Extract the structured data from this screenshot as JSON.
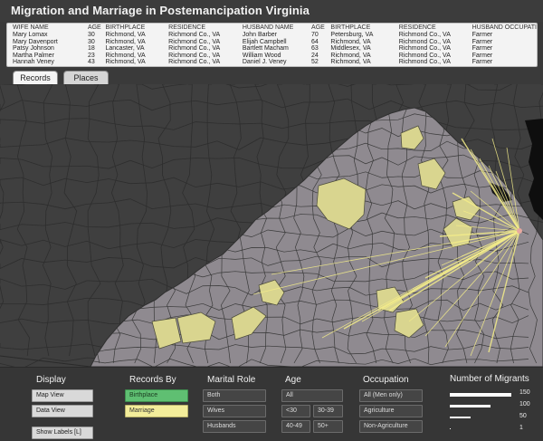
{
  "app": {
    "title": "Migration and Marriage in Postemancipation Virginia"
  },
  "records": {
    "headers": [
      "WIFE NAME",
      "AGE",
      "BIRTHPLACE",
      "RESIDENCE",
      "HUSBAND NAME",
      "AGE",
      "BIRTHPLACE",
      "RESIDENCE",
      "HUSBAND OCCUPATI"
    ],
    "rows": [
      [
        "Mary Lomax",
        "30",
        "Richmond, VA",
        "Richmond Co., VA",
        "John Barber",
        "70",
        "Petersburg, VA",
        "Richmond Co., VA",
        "Farmer"
      ],
      [
        "Mary Davenport",
        "30",
        "Richmond, VA",
        "Richmond Co., VA",
        "Elijah Campbell",
        "64",
        "Richmond, VA",
        "Richmond Co., VA",
        "Farmer"
      ],
      [
        "Patsy Johnson",
        "18",
        "Lancaster, VA",
        "Richmond Co., VA",
        "Bartlett Macham",
        "63",
        "Middlesex, VA",
        "Richmond Co., VA",
        "Farmer"
      ],
      [
        "Martha Palmer",
        "23",
        "Richmond, VA",
        "Richmond Co., VA",
        "William Wood",
        "24",
        "Richmond, VA",
        "Richmond Co., VA",
        "Farmer"
      ],
      [
        "Hannah Veney",
        "43",
        "Richmond, VA",
        "Richmond Co., VA",
        "Daniel J. Veney",
        "52",
        "Richmond, VA",
        "Richmond Co., VA",
        "Farmer"
      ]
    ]
  },
  "tabs": [
    {
      "label": "Records",
      "active": true
    },
    {
      "label": "Places",
      "active": false
    }
  ],
  "controls": {
    "display": {
      "title": "Display",
      "map_view": "Map View",
      "data_view": "Data View",
      "show_labels": "Show Labels [L]"
    },
    "records_by": {
      "title": "Records By",
      "birthplace": "Birthplace",
      "marriage": "Marriage"
    },
    "marital_role": {
      "title": "Marital Role",
      "both": "Both",
      "wives": "Wives",
      "husbands": "Husbands"
    },
    "age": {
      "title": "Age",
      "all": "All",
      "under30": "<30",
      "30to39": "30-39",
      "40to49": "40-49",
      "50plus": "50+"
    },
    "occupation": {
      "title": "Occupation",
      "all": "All (Men only)",
      "agriculture": "Agriculture",
      "non_agriculture": "Non-Agriculture"
    },
    "migrants_legend": {
      "title": "Number of Migrants",
      "items": [
        {
          "label": "150",
          "value": 150
        },
        {
          "label": "100",
          "value": 100
        },
        {
          "label": "50",
          "value": 50
        },
        {
          "label": "1",
          "value": 1
        }
      ]
    }
  },
  "colors": {
    "virginia_fill": "#8f8a90",
    "neighbor_fill": "#474747",
    "county_border": "#333333",
    "highlight_fill": "#d9d58f",
    "flow_line": "#f3ec8a",
    "birthplace_green": "#5fbf72",
    "marriage_yellow": "#f3ed9a"
  }
}
